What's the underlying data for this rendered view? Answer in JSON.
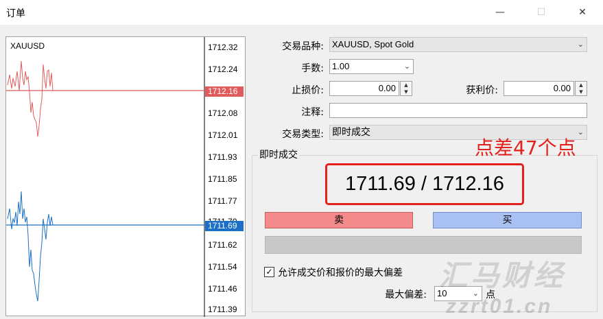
{
  "window": {
    "title": "订单",
    "minimize_icon": "minimize-icon",
    "maximize_icon": "maximize-icon",
    "close_icon": "close-icon"
  },
  "chart": {
    "symbol": "XAUUSD",
    "price_levels": [
      "1712.32",
      "1712.24",
      "1712.16",
      "1712.08",
      "1712.01",
      "1711.93",
      "1711.85",
      "1711.77",
      "1711.70",
      "1711.62",
      "1711.54",
      "1711.46",
      "1711.39"
    ],
    "ask_tag": "1712.16",
    "bid_tag": "1711.69",
    "ask_color": "#e05b5b",
    "bid_color": "#1a6fc6"
  },
  "form": {
    "symbol_label": "交易品种:",
    "symbol_value": "XAUUSD, Spot Gold",
    "volume_label": "手数:",
    "volume_value": "1.00",
    "sl_label": "止损价:",
    "sl_value": "0.00",
    "tp_label": "获利价:",
    "tp_value": "0.00",
    "comment_label": "注释:",
    "comment_value": "",
    "type_label": "交易类型:",
    "type_value": "即时成交"
  },
  "execution": {
    "group_title": "即时成交",
    "quote": "1711.69 / 1712.16",
    "annotation": "点差47个点",
    "sell_label": "卖",
    "buy_label": "买",
    "sell_color": "#f58a8a",
    "buy_color": "#a9c1f2",
    "allow_deviation_label": "允许成交价和报价的最大偏差",
    "allow_deviation_checked": "✓",
    "max_deviation_label": "最大偏差:",
    "max_deviation_value": "10",
    "points_unit": "点"
  },
  "watermark": {
    "brand": "汇马财经",
    "url": "zzrt01.cn"
  }
}
